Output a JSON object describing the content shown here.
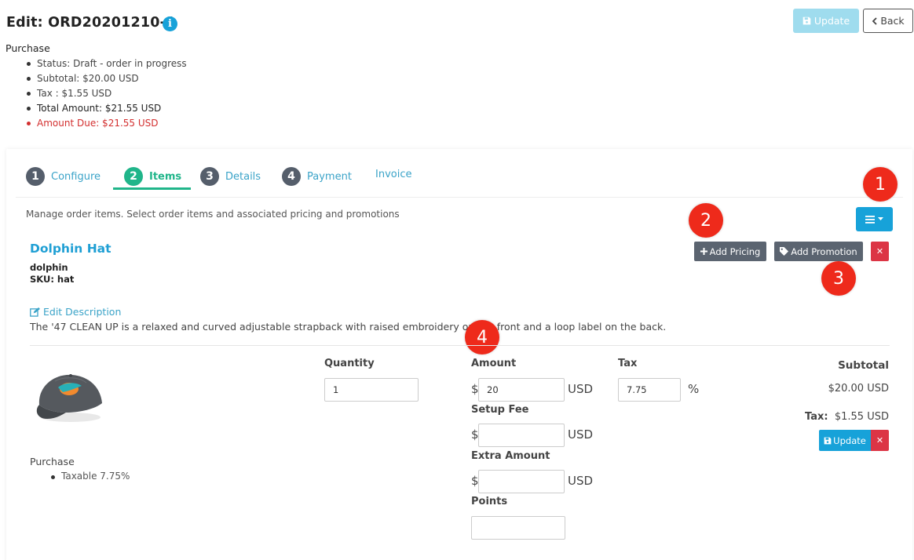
{
  "header": {
    "title": "Edit: ORD20201210-1",
    "update_label": "Update",
    "back_label": "Back"
  },
  "summary": {
    "heading": "Purchase",
    "status": "Status: Draft - order in progress",
    "subtotal": "Subtotal: $20.00 USD",
    "tax": "Tax : $1.55 USD",
    "total": "Total Amount: $21.55 USD",
    "due": "Amount Due: $21.55 USD"
  },
  "tabs": [
    {
      "num": "1",
      "label": "Configure"
    },
    {
      "num": "2",
      "label": "Items"
    },
    {
      "num": "3",
      "label": "Details"
    },
    {
      "num": "4",
      "label": "Payment"
    },
    {
      "label": "Invoice"
    }
  ],
  "active_tab": "Items",
  "items_panel": {
    "description": "Manage order items. Select order items and associated pricing and promotions"
  },
  "badges": [
    "1",
    "2",
    "3",
    "4"
  ],
  "item": {
    "name": "Dolphin Hat",
    "code": "dolphin",
    "sku": "SKU: hat",
    "add_pricing_label": "Add Pricing",
    "add_promotion_label": "Add Promotion",
    "edit_description_label": "Edit Description",
    "description": "The '47 CLEAN UP is a relaxed and curved adjustable strapback with raised embroidery on the front and a loop label on the back.",
    "quantity_label": "Quantity",
    "quantity_value": "1",
    "amount_label": "Amount",
    "amount_currency": "$",
    "amount_value": "20",
    "amount_unit": "USD",
    "tax_label": "Tax",
    "tax_value": "7.75",
    "tax_unit": "%",
    "setup_fee_label": "Setup Fee",
    "setup_fee_currency": "$",
    "setup_fee_value": "",
    "setup_fee_unit": "USD",
    "extra_amount_label": "Extra Amount",
    "extra_amount_currency": "$",
    "extra_amount_value": "",
    "extra_amount_unit": "USD",
    "points_label": "Points",
    "points_value": "",
    "subtotal_label": "Subtotal",
    "subtotal_value": "$20.00 USD",
    "tax_total_label": "Tax:",
    "tax_total_value": "$1.55 USD",
    "update_label": "Update",
    "purchase_label": "Purchase",
    "taxable": "Taxable 7.75%"
  },
  "colors": {
    "accent": "#17a2d9",
    "active_tab": "#20b58a",
    "danger": "#dc3545",
    "badge": "#ee2a1b",
    "update_disabled": "#9fdcee"
  },
  "icons": [
    "info-icon",
    "save-icon",
    "chevron-left-icon",
    "bars-icon",
    "caret-down-icon",
    "plus-icon",
    "tag-icon",
    "times-icon",
    "edit-icon"
  ]
}
